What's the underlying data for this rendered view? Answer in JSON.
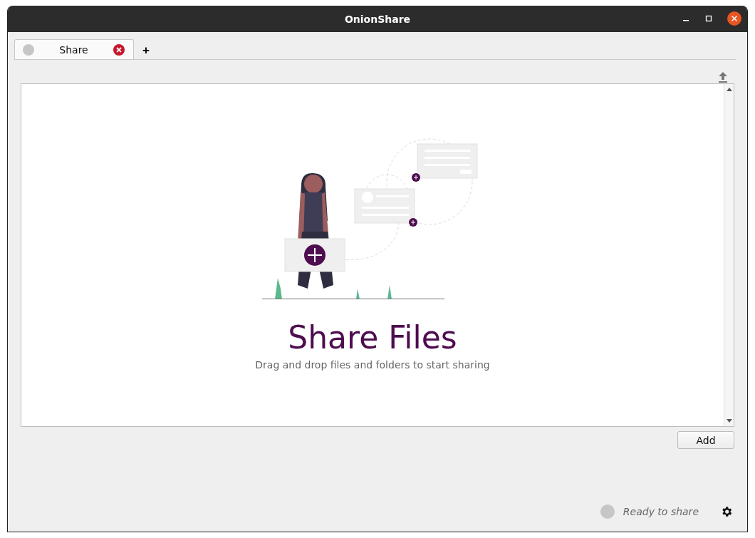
{
  "window": {
    "title": "OnionShare"
  },
  "tabs": [
    {
      "label": "Share",
      "selected": true
    }
  ],
  "new_tab": {
    "label": "+"
  },
  "drop_zone": {
    "title": "Share Files",
    "subtitle": "Drag and drop files and folders to start sharing"
  },
  "add_button": {
    "label": "Add"
  },
  "status_bar": {
    "text": "Ready to share"
  }
}
